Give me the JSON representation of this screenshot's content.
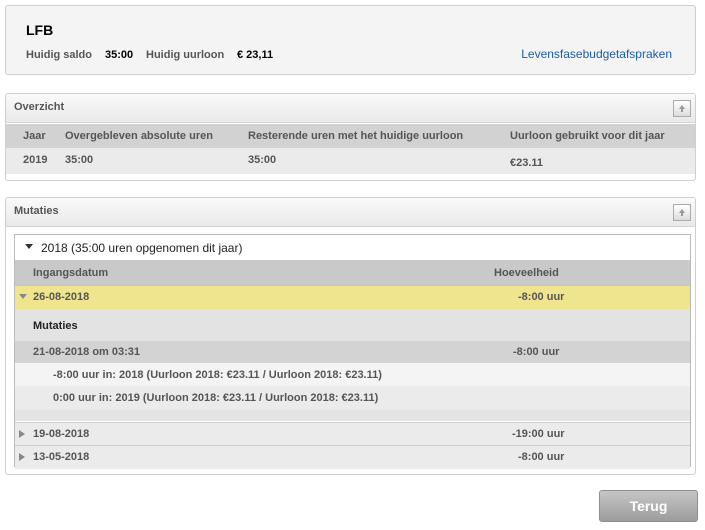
{
  "header": {
    "title": "LFB",
    "saldo_label": "Huidig saldo",
    "saldo_value": "35:00",
    "uurloon_label": "Huidig uurloon",
    "uurloon_value": "€ 23,11",
    "link": "Levensfasebudgetafspraken"
  },
  "overzicht": {
    "title": "Overzicht",
    "columns": [
      "Jaar",
      "Overgebleven absolute uren",
      "Resterende uren met het huidige uurloon",
      "Uurloon gebruikt voor dit jaar"
    ],
    "row": [
      "2019",
      "35:00",
      "35:00",
      "€23.11"
    ]
  },
  "mutaties": {
    "title": "Mutaties",
    "year_header": "2018 (35:00 uren opgenomen dit jaar)",
    "columns": [
      "Ingangsdatum",
      "Hoeveelheid"
    ],
    "selected": {
      "date": "26-08-2018",
      "amount": "-8:00 uur"
    },
    "detail": {
      "title": "Mutaties",
      "entry_date": "21-08-2018 om 03:31",
      "entry_amount": "-8:00 uur",
      "lines": [
        "-8:00 uur in: 2018 (Uurloon 2018: €23.11 / Uurloon 2018: €23.11)",
        "0:00 uur in: 2019 (Uurloon 2018: €23.11 / Uurloon 2018: €23.11)"
      ]
    },
    "rows": [
      {
        "date": "19-08-2018",
        "amount": "-19:00 uur"
      },
      {
        "date": "13-05-2018",
        "amount": "-8:00 uur"
      }
    ]
  },
  "buttons": {
    "back": "Terug"
  }
}
